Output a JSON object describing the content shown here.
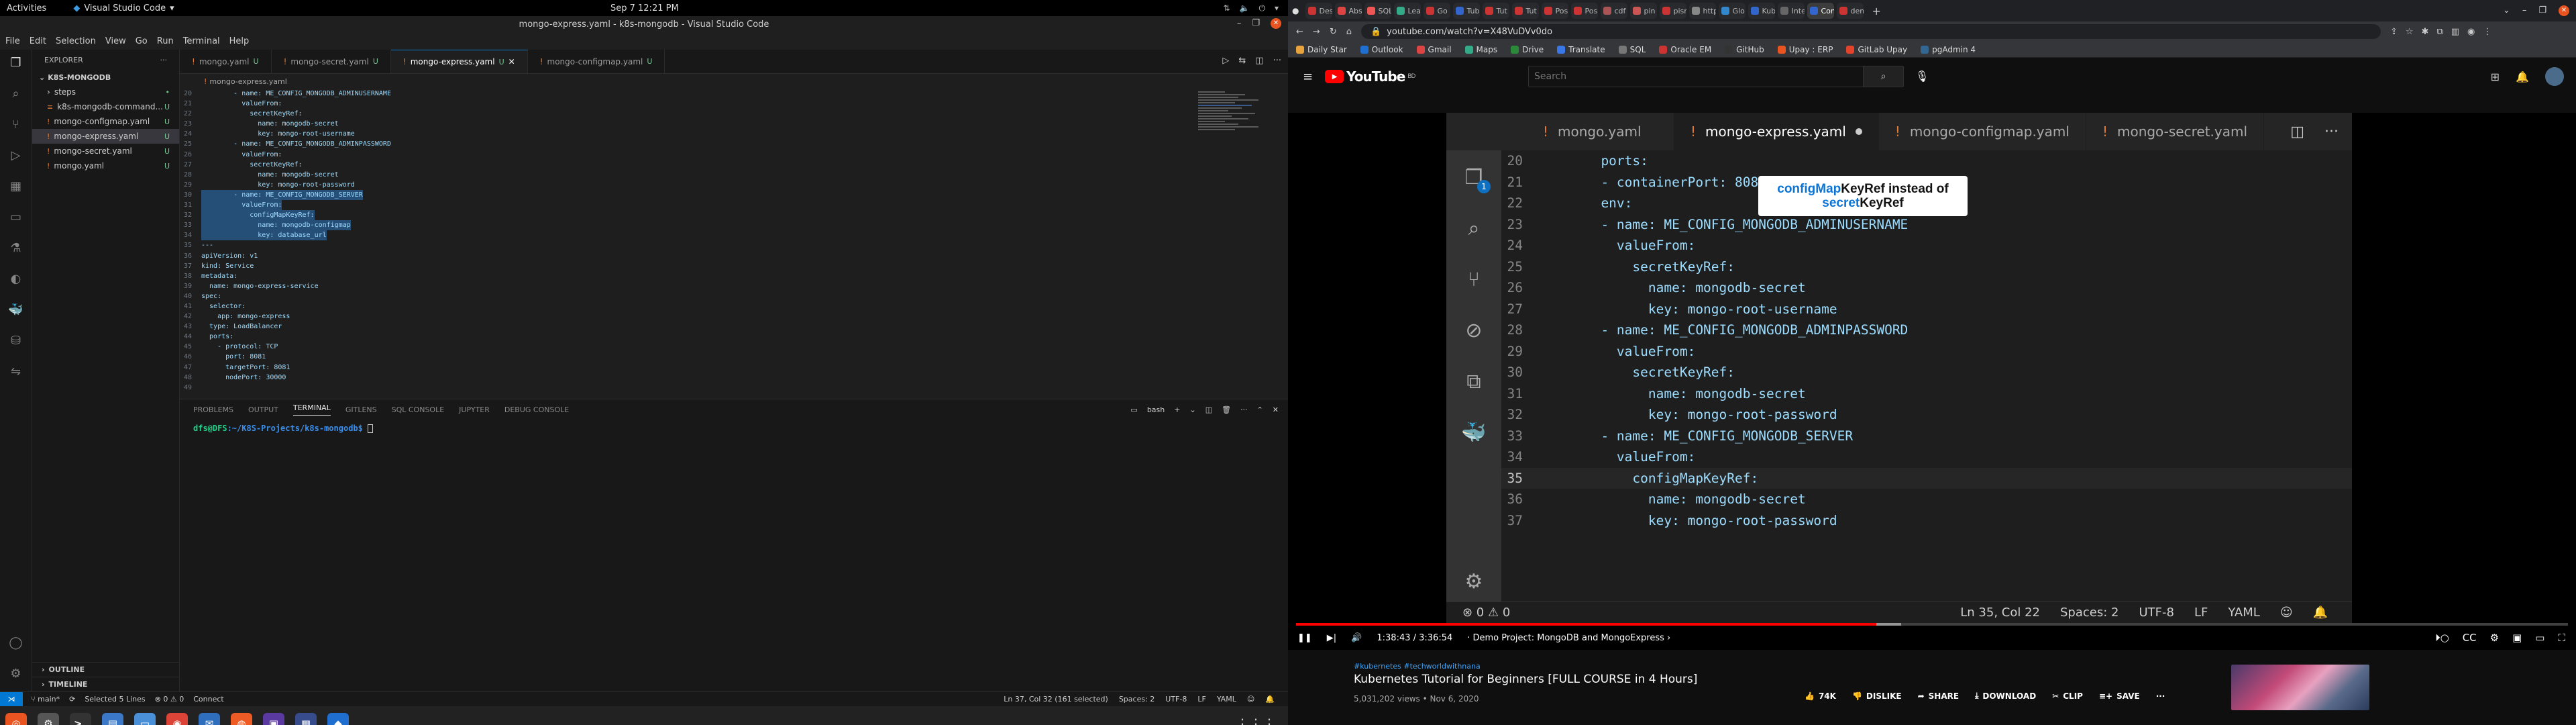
{
  "topbar": {
    "activities": "Activities",
    "app": "Visual Studio Code",
    "clock": "Sep 7  12:21 PM"
  },
  "vscode": {
    "title": "mongo-express.yaml - k8s-mongodb - Visual Studio Code",
    "menu": [
      "File",
      "Edit",
      "Selection",
      "View",
      "Go",
      "Run",
      "Terminal",
      "Help"
    ],
    "explorer": {
      "header": "EXPLORER",
      "project": "K8S-MONGODB",
      "items": [
        {
          "name": "steps",
          "badge": "•",
          "type": "folder"
        },
        {
          "name": "k8s-mongodb-command...",
          "badge": "U",
          "type": "file"
        },
        {
          "name": "mongo-configmap.yaml",
          "badge": "U",
          "type": "file"
        },
        {
          "name": "mongo-express.yaml",
          "badge": "U",
          "type": "file"
        },
        {
          "name": "mongo-secret.yaml",
          "badge": "U",
          "type": "file"
        },
        {
          "name": "mongo.yaml",
          "badge": "U",
          "type": "file"
        }
      ],
      "outline": "OUTLINE",
      "timeline": "TIMELINE"
    },
    "tabs": [
      {
        "label": "mongo.yaml",
        "flag": "U"
      },
      {
        "label": "mongo-secret.yaml",
        "flag": "U"
      },
      {
        "label": "mongo-express.yaml",
        "flag": "U"
      },
      {
        "label": "mongo-configmap.yaml",
        "flag": "U"
      }
    ],
    "breadcrumb": "mongo-express.yaml",
    "code": [
      {
        "n": "20",
        "t": "        - name: ME_CONFIG_MONGODB_ADMINUSERNAME"
      },
      {
        "n": "21",
        "t": "          valueFrom:"
      },
      {
        "n": "22",
        "t": "            secretKeyRef:"
      },
      {
        "n": "23",
        "t": "              name: mongodb-secret"
      },
      {
        "n": "24",
        "t": "              key: mongo-root-username"
      },
      {
        "n": "25",
        "t": "        - name: ME_CONFIG_MONGODB_ADMINPASSWORD"
      },
      {
        "n": "26",
        "t": "          valueFrom:"
      },
      {
        "n": "27",
        "t": "            secretKeyRef:"
      },
      {
        "n": "28",
        "t": "              name: mongodb-secret"
      },
      {
        "n": "29",
        "t": "              key: mongo-root-password"
      },
      {
        "n": "30",
        "t": "        - name: ME_CONFIG_MONGODB_SERVER"
      },
      {
        "n": "31",
        "t": "          valueFrom:"
      },
      {
        "n": "32",
        "t": "            configMapKeyRef:"
      },
      {
        "n": "33",
        "t": "              name: mongodb-configmap"
      },
      {
        "n": "34",
        "t": "              key: database_url"
      },
      {
        "n": "35",
        "t": "---"
      },
      {
        "n": "36",
        "t": "apiVersion: v1"
      },
      {
        "n": "37",
        "t": "kind: Service"
      },
      {
        "n": "38",
        "t": "metadata:"
      },
      {
        "n": "39",
        "t": "  name: mongo-express-service"
      },
      {
        "n": "40",
        "t": "spec:"
      },
      {
        "n": "41",
        "t": "  selector:"
      },
      {
        "n": "42",
        "t": "    app: mongo-express"
      },
      {
        "n": "43",
        "t": "  type: LoadBalancer"
      },
      {
        "n": "44",
        "t": "  ports:"
      },
      {
        "n": "45",
        "t": "    - protocol: TCP"
      },
      {
        "n": "46",
        "t": "      port: 8081"
      },
      {
        "n": "47",
        "t": "      targetPort: 8081"
      },
      {
        "n": "48",
        "t": "      nodePort: 30000"
      },
      {
        "n": "49",
        "t": ""
      }
    ],
    "panel_tabs": [
      "PROBLEMS",
      "OUTPUT",
      "TERMINAL",
      "GITLENS",
      "SQL CONSOLE",
      "JUPYTER",
      "DEBUG CONSOLE"
    ],
    "panel_right": "bash",
    "terminal": {
      "user": "dfs@DFS",
      "path": ":~/K8S-Projects/k8s-mongodb$"
    },
    "status": {
      "branch": "main*",
      "selected": "Selected 5 Lines",
      "problems": "⊗ 0 ⚠ 0",
      "connect": "Connect",
      "pos": "Ln 37, Col 32 (161 selected)",
      "spaces": "Spaces: 2",
      "enc": "UTF-8",
      "eol": "LF",
      "lang": "YAML"
    }
  },
  "browser": {
    "url": "youtube.com/watch?v=X48VuDVv0do",
    "bookmarks": [
      "Daily Star",
      "Outlook",
      "Gmail",
      "Maps",
      "Drive",
      "Translate",
      "SQL",
      "Oracle EM",
      "GitHub",
      "Upay : ERP",
      "GitLab Upay",
      "pgAdmin 4"
    ],
    "tabs": [
      "Des",
      "Abs",
      "SQL",
      "Lea",
      "Go",
      "Tub",
      "Tut",
      "Tut",
      "Pos",
      "Pos",
      "cdf",
      "pin",
      "pisr",
      "http",
      "Glo",
      "Kub",
      "Inte",
      "Con",
      "dem"
    ],
    "search_placeholder": "Search",
    "logo": "YouTube",
    "logo_sup": "BD"
  },
  "video": {
    "tabs": [
      {
        "label": "mongo.yaml"
      },
      {
        "label": "mongo-express.yaml"
      },
      {
        "label": "mongo-configmap.yaml"
      },
      {
        "label": "mongo-secret.yaml"
      }
    ],
    "activity_badge": "1",
    "code": [
      {
        "n": "20",
        "t": "      ports:"
      },
      {
        "n": "21",
        "t": "      - containerPort: 8081"
      },
      {
        "n": "22",
        "t": "      env:"
      },
      {
        "n": "23",
        "t": "      - name: ME_CONFIG_MONGODB_ADMINUSERNAME"
      },
      {
        "n": "24",
        "t": "        valueFrom:"
      },
      {
        "n": "25",
        "t": "          secretKeyRef:"
      },
      {
        "n": "26",
        "t": "            name: mongodb-secret"
      },
      {
        "n": "27",
        "t": "            key: mongo-root-username"
      },
      {
        "n": "28",
        "t": "      - name: ME_CONFIG_MONGODB_ADMINPASSWORD"
      },
      {
        "n": "29",
        "t": "        valueFrom:"
      },
      {
        "n": "30",
        "t": "          secretKeyRef:"
      },
      {
        "n": "31",
        "t": "            name: mongodb-secret"
      },
      {
        "n": "32",
        "t": "            key: mongo-root-password"
      },
      {
        "n": "33",
        "t": "      - name: ME_CONFIG_MONGODB_SERVER"
      },
      {
        "n": "34",
        "t": "        valueFrom:"
      },
      {
        "n": "35",
        "t": "          configMapKeyRef:"
      },
      {
        "n": "36",
        "t": "            name: mongodb-secret"
      },
      {
        "n": "37",
        "t": "            key: mongo-root-password"
      }
    ],
    "caption": {
      "a": "configMap",
      "b": "KeyRef instead of",
      "c": "secret",
      "d": "KeyRef"
    },
    "status": {
      "problems": "⊗ 0  ⚠ 0",
      "pos": "Ln 35, Col 22",
      "spaces": "Spaces: 2",
      "enc": "UTF-8",
      "eol": "LF",
      "lang": "YAML"
    },
    "time": "1:38:43 / 3:36:54",
    "chapter": "· Demo Project: MongoDB and MongoExpress ›",
    "progress": 0.456
  },
  "info": {
    "tags": "#kubernetes #techworldwithnana",
    "title": "Kubernetes Tutorial for Beginners [FULL COURSE in 4 Hours]",
    "meta": "5,031,202 views • Nov 6, 2020",
    "likes": "74K",
    "dislike": "DISLIKE",
    "share": "SHARE",
    "download": "DOWNLOAD",
    "clip": "CLIP",
    "save": "SAVE"
  }
}
